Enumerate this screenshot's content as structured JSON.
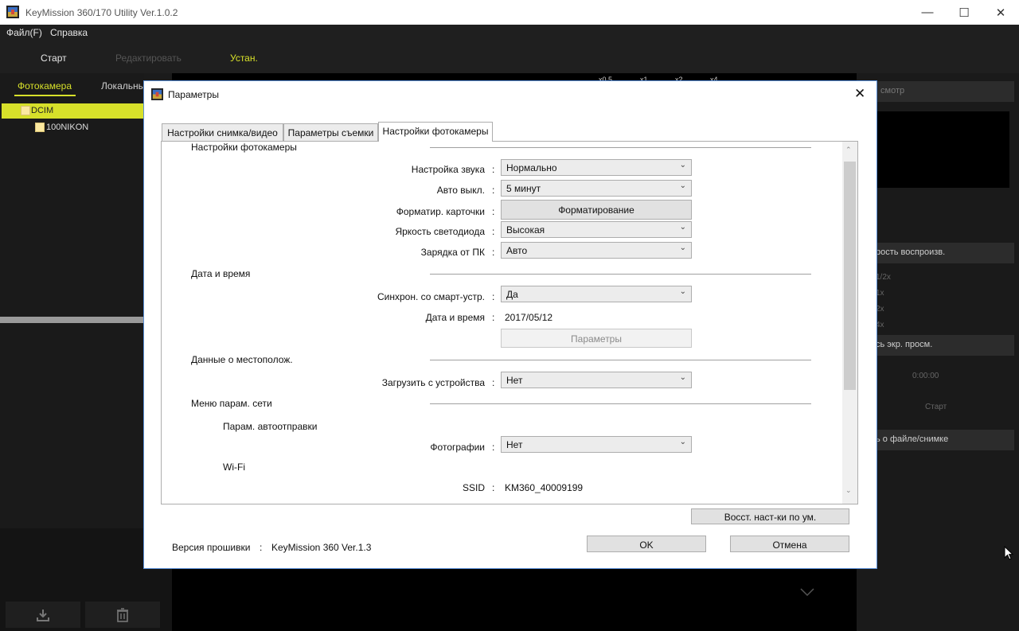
{
  "window": {
    "title": "KeyMission 360/170 Utility Ver.1.0.2",
    "minimize_icon": "minimize-icon",
    "maximize_icon": "maximize-icon",
    "close_icon": "close-icon"
  },
  "menu": {
    "file": "Файл(F)",
    "help": "Справка"
  },
  "toolbar": {
    "start": "Старт",
    "edit": "Редактировать",
    "setup": "Устан."
  },
  "left_panel": {
    "tab_camera": "Фотокамера",
    "tab_local": "Локальны",
    "tree": {
      "root": "DCIM",
      "child": "100NIKON"
    }
  },
  "preview": {
    "zoom_levels": [
      "x0.5",
      "x1",
      "x2",
      "x4"
    ]
  },
  "right_panel": {
    "view_header": "смотр",
    "playback_speed": "рость воспроизв.",
    "speed_options": [
      "1/2x",
      "1x",
      "2x",
      "4x"
    ],
    "screen_record": "сь экр. просм.",
    "time": "0:00:00",
    "start": "Старт",
    "file_info": "ь о файле/снимке"
  },
  "dialog": {
    "title": "Параметры",
    "tabs": [
      "Настройки снимка/видео",
      "Параметры съемки",
      "Настройки фотокамеры"
    ],
    "sections": {
      "camera": "Настройки фотокамеры",
      "datetime": "Дата и время",
      "location": "Данные о местополож.",
      "network": "Меню парам. сети",
      "auto_send": "Парам. автоотправки",
      "wifi": "Wi-Fi"
    },
    "fields": {
      "sound": {
        "label": "Настройка звука",
        "value": "Нормально"
      },
      "auto_off": {
        "label": "Авто выкл.",
        "value": "5 минут"
      },
      "format": {
        "label": "Форматир. карточки",
        "button": "Форматирование"
      },
      "led": {
        "label": "Яркость светодиода",
        "value": "Высокая"
      },
      "pc_charge": {
        "label": "Зарядка от ПК",
        "value": "Авто"
      },
      "sync": {
        "label": "Синхрон. со смарт-устр.",
        "value": "Да"
      },
      "date": {
        "label": "Дата и время",
        "value": "2017/05/12",
        "button": "Параметры"
      },
      "download": {
        "label": "Загрузить с устройства",
        "value": "Нет"
      },
      "photos": {
        "label": "Фотографии",
        "value": "Нет"
      },
      "ssid": {
        "label": "SSID",
        "value": "KM360_40009199"
      }
    },
    "reset_button": "Восст. наст-ки по ум.",
    "firmware_label": "Версия прошивки",
    "firmware_value": "KeyMission 360 Ver.1.3",
    "ok": "OK",
    "cancel": "Отмена"
  },
  "colors": {
    "accent": "#d7e02a",
    "dark_bg": "#1b1b1b",
    "dialog_bg": "#ffffff"
  }
}
